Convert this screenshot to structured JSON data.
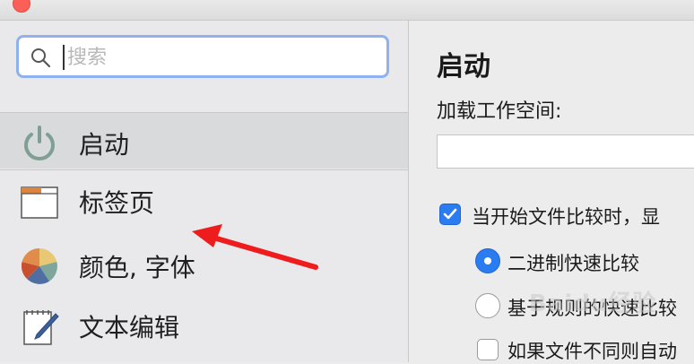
{
  "search": {
    "placeholder": "搜索"
  },
  "sidebar": {
    "items": [
      {
        "label": "启动"
      },
      {
        "label": "标签页"
      },
      {
        "label": "颜色, 字体"
      },
      {
        "label": "文本编辑"
      }
    ]
  },
  "content": {
    "title": "启动",
    "workspace_label": "加载工作空间:",
    "workspace_value": "",
    "options": [
      {
        "label": "当开始文件比较时，显",
        "checked": true
      },
      {
        "label": "二进制快速比较",
        "selected": true
      },
      {
        "label": "基于规则的快速比较",
        "selected": false
      },
      {
        "label": "如果文件不同则自动",
        "checked": false
      }
    ]
  },
  "watermark": "Baidu经验",
  "colors": {
    "accent": "#2b7cf0",
    "arrow": "#ee1c1c",
    "search_focus": "#8fb2ee"
  }
}
